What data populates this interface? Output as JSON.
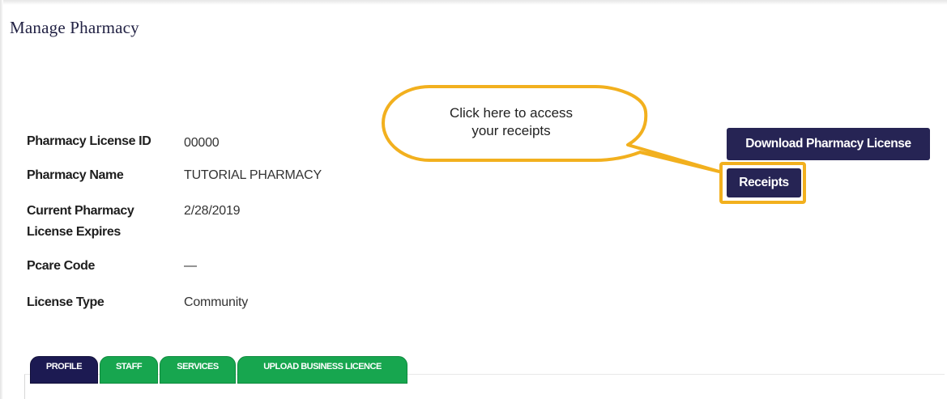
{
  "page": {
    "title": "Manage Pharmacy"
  },
  "details": [
    {
      "label": "Pharmacy License ID",
      "value": "00000"
    },
    {
      "label": "Pharmacy Name",
      "value": "TUTORIAL PHARMACY"
    },
    {
      "label": "Current Pharmacy License Expires",
      "value": "2/28/2019"
    },
    {
      "label": "Pcare Code",
      "value": "—"
    },
    {
      "label": "License Type",
      "value": "Community"
    }
  ],
  "actions": {
    "download_label": "Download Pharmacy License",
    "receipts_label": "Receipts"
  },
  "callout": {
    "line1": "Click here to access",
    "line2": "your receipts"
  },
  "tabs": [
    {
      "label": "PROFILE",
      "active": true
    },
    {
      "label": "STAFF",
      "active": false
    },
    {
      "label": "SERVICES",
      "active": false
    },
    {
      "label": "UPLOAD BUSINESS LICENCE",
      "active": false
    }
  ],
  "colors": {
    "navy": "#262454",
    "tab_active": "#1c1a52",
    "tab_green": "#17a64f",
    "highlight": "#f2b01e"
  }
}
